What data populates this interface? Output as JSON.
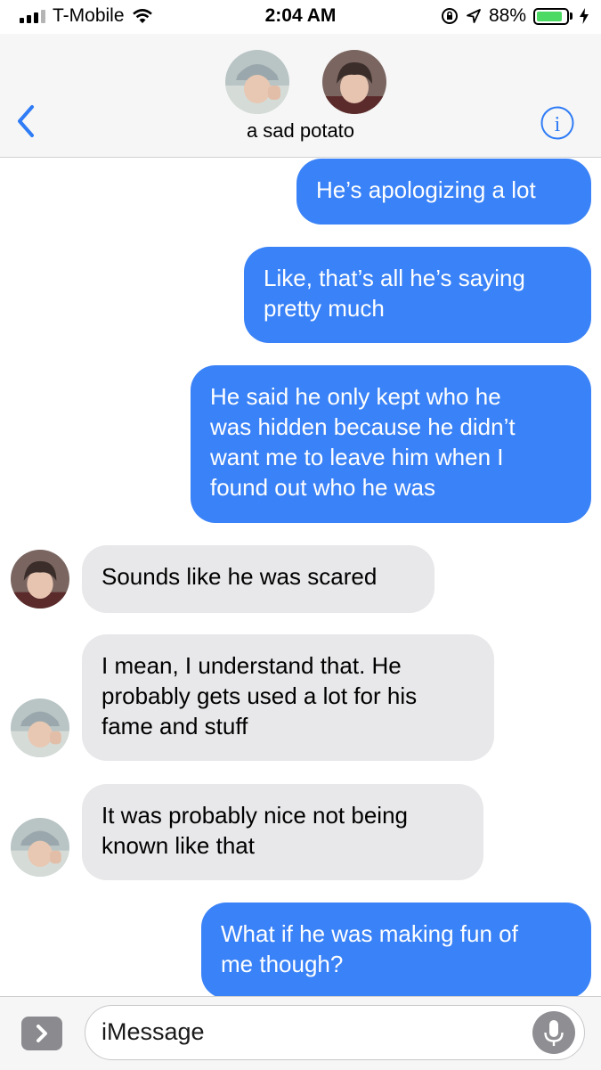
{
  "status_bar": {
    "carrier": "T-Mobile",
    "time": "2:04 AM",
    "battery_percent_label": "88%",
    "battery_level": 0.88
  },
  "header": {
    "contact_name": "a sad potato",
    "back_icon": "chevron-left-icon",
    "info_icon": "info-icon"
  },
  "messages": [
    {
      "direction": "sent",
      "text": "He’s apologizing a lot"
    },
    {
      "direction": "sent",
      "text": "Like, that’s all he’s saying\npretty much"
    },
    {
      "direction": "sent",
      "text": "He said he only kept who he\nwas hidden because he didn’t\nwant me to leave him when I\nfound out who he was"
    },
    {
      "direction": "received",
      "sender": "dark-hair-avatar",
      "text": "Sounds like he was scared"
    },
    {
      "direction": "received",
      "sender": "bucket-hat-avatar",
      "text": "I mean, I understand that. He\nprobably gets used a lot for his\nfame and stuff"
    },
    {
      "direction": "received",
      "sender": "bucket-hat-avatar",
      "text": "It was probably nice not being\nknown like that"
    },
    {
      "direction": "sent",
      "text": "What if he was making fun of\nme though?"
    }
  ],
  "input": {
    "placeholder": "iMessage",
    "app_icon": "chevron-right-icon",
    "mic_icon": "microphone-icon"
  },
  "colors": {
    "sent_bubble": "#3a82f7",
    "received_bubble": "#e8e8ea",
    "accent": "#2f7cf6",
    "battery": "#4cd964"
  }
}
